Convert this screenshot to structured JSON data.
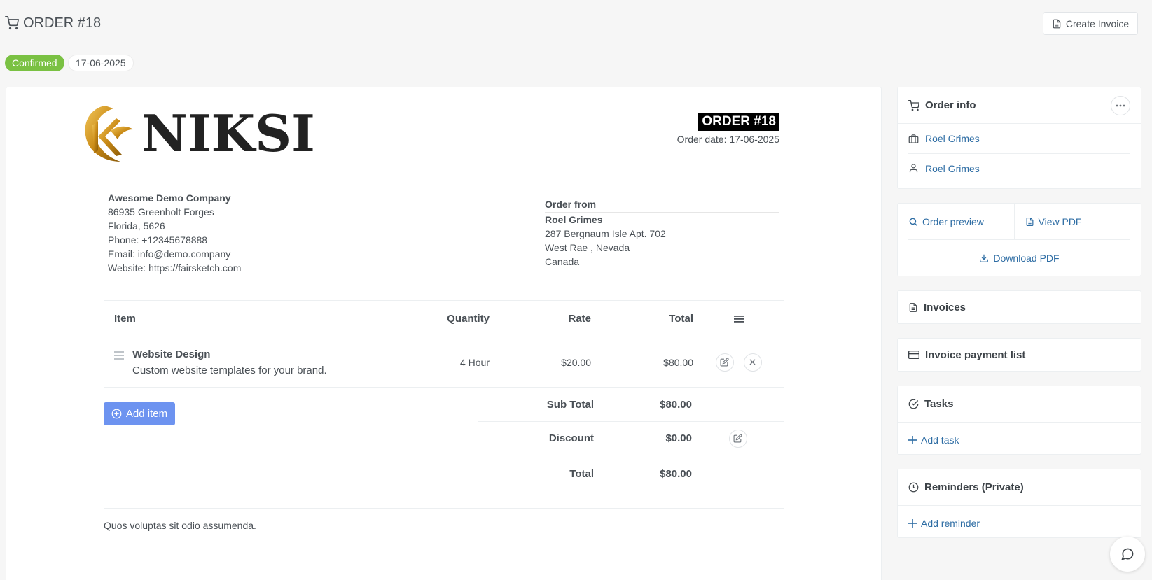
{
  "header": {
    "title": "ORDER #18",
    "create_invoice_label": "Create Invoice",
    "status": "Confirmed",
    "date": "17-06-2025"
  },
  "colors": {
    "status_green": "#7ac143",
    "primary_blue": "#6d93f0",
    "link_blue": "#2e6da4"
  },
  "document": {
    "logo_text": "NIKSI",
    "order_title": "ORDER #18",
    "order_date": "Order date: 17-06-2025",
    "company": {
      "name": "Awesome Demo Company",
      "address": "86935 Greenholt Forges",
      "city": "Florida, 5626",
      "phone": "Phone: +12345678888",
      "email": "Email: info@demo.company",
      "website": "Website: https://fairsketch.com"
    },
    "order_from": {
      "label": "Order from",
      "name": "Roel Grimes",
      "address": "287 Bergnaum Isle Apt. 702",
      "city": "West Rae , Nevada",
      "country": "Canada"
    },
    "table": {
      "headers": {
        "item": "Item",
        "quantity": "Quantity",
        "rate": "Rate",
        "total": "Total"
      },
      "rows": [
        {
          "name": "Website Design",
          "description": "Custom website templates for your brand.",
          "quantity": "4 Hour",
          "rate": "$20.00",
          "total": "$80.00"
        }
      ]
    },
    "add_item_label": "Add item",
    "totals": {
      "sub_total_label": "Sub Total",
      "sub_total": "$80.00",
      "discount_label": "Discount",
      "discount": "$0.00",
      "total_label": "Total",
      "total": "$80.00"
    },
    "note": "Quos voluptas sit odio assumenda."
  },
  "sidebar": {
    "order_info": {
      "title": "Order info",
      "company_link": "Roel Grimes",
      "contact_link": "Roel Grimes"
    },
    "preview": {
      "order_preview": "Order preview",
      "view_pdf": "View PDF",
      "download_pdf": "Download PDF"
    },
    "invoices_title": "Invoices",
    "payment_list_title": "Invoice payment list",
    "tasks": {
      "title": "Tasks",
      "add_label": "Add task"
    },
    "reminders": {
      "title": "Reminders (Private)",
      "add_label": "Add reminder"
    }
  }
}
